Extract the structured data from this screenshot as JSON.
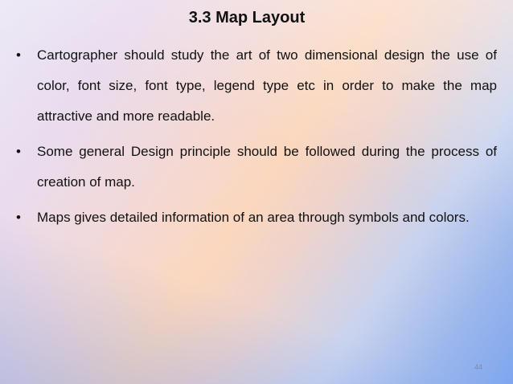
{
  "slide": {
    "title": "3.3 Map Layout",
    "bullets": [
      "Cartographer should study the art of two dimensional design  the use of color, font size, font type, legend type etc in order to make the map attractive and more readable.",
      "Some general Design principle should be followed during the process of creation of map.",
      "Maps gives detailed information of an area through symbols and colors."
    ],
    "page_number": "44"
  }
}
